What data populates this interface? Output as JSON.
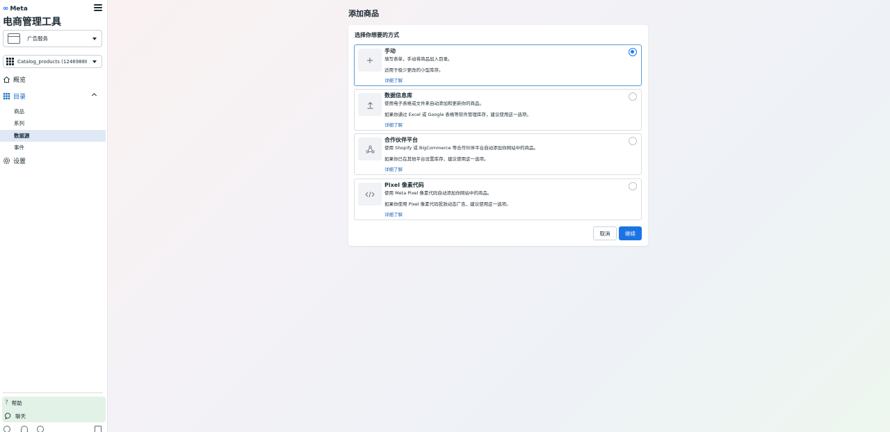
{
  "sidebar": {
    "brand": "Meta",
    "app_title": "电商管理工具",
    "business_select": "广告服务",
    "catalog_select": "Catalog_products (12469888...",
    "nav": {
      "overview": "概览",
      "catalog": "目录",
      "settings": "设置"
    },
    "catalog_items": [
      "商品",
      "系列",
      "数据源",
      "事件"
    ],
    "selected_catalog_item": "数据源",
    "help": "帮助",
    "chat": "聊天"
  },
  "main": {
    "page_title": "添加商品",
    "card_heading": "选择你想要的方式",
    "options": [
      {
        "title": "手动",
        "desc": "填写表单，手动将商品加入目录。",
        "note": "适用于极少更改的小型库存。",
        "link": "详细了解",
        "icon": "plus-icon",
        "selected": true
      },
      {
        "title": "数据信息库",
        "desc": "使用电子表格或文件来自动添加和更新你的商品。",
        "note": "如果你通过 Excel 或 Google 表格等软件管理库存，建议使用这一选项。",
        "link": "详细了解",
        "icon": "upload-icon",
        "selected": false
      },
      {
        "title": "合作伙伴平台",
        "desc": "使用 Shopify 或 BigCommerce 等合作伙伴平台自动添加你网站中的商品。",
        "note": "如果你已在其他平台设置库存，建议使用这一选项。",
        "link": "详细了解",
        "icon": "network-icon",
        "selected": false
      },
      {
        "title": "Pixel 像素代码",
        "desc": "使用 Meta Pixel 像素代码自动添加你网站中的商品。",
        "note": "如果你使用 Pixel 像素代码投放动态广告，建议使用这一选项。",
        "link": "详细了解",
        "icon": "code-icon",
        "selected": false
      }
    ],
    "cancel_label": "取消",
    "continue_label": "继续"
  },
  "colors": {
    "accent": "#1b74e4",
    "link": "#1d65c1",
    "selected_border": "#5b9bd5"
  }
}
